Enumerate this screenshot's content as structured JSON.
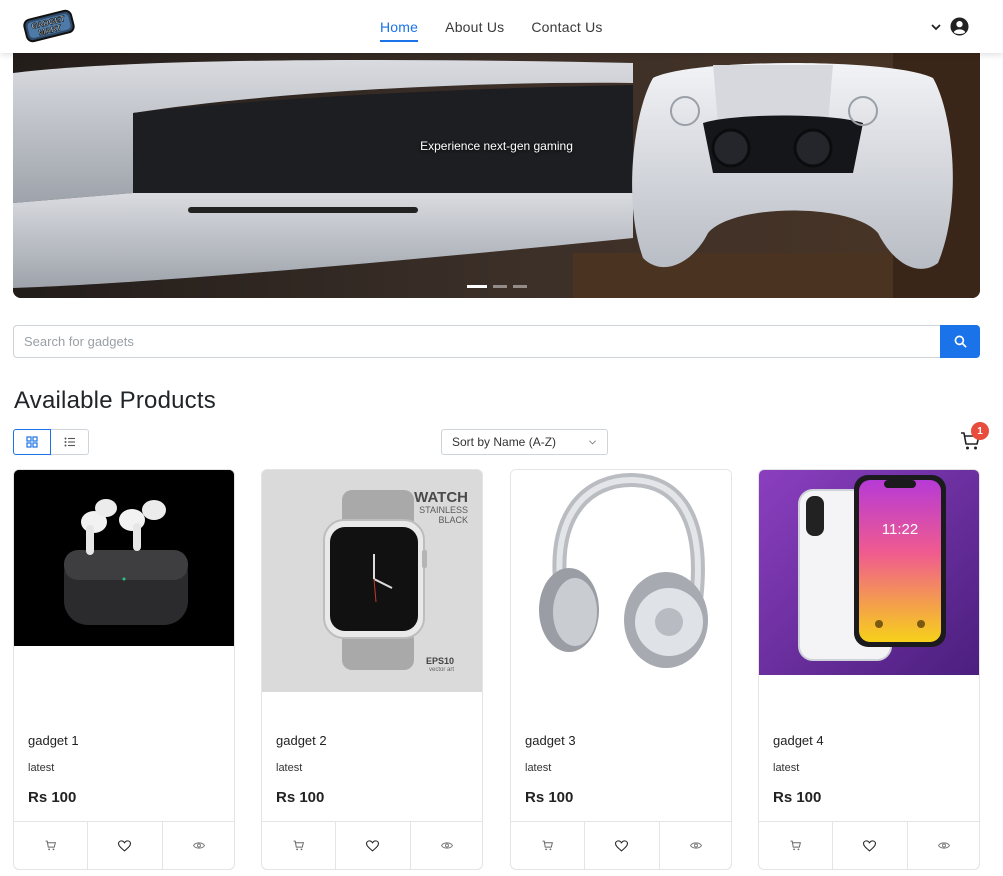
{
  "navbar": {
    "logo_text": "GADGET MART",
    "links": [
      {
        "label": "Home",
        "active": true
      },
      {
        "label": "About Us",
        "active": false
      },
      {
        "label": "Contact Us",
        "active": false
      }
    ],
    "icons": [
      "chevron-down-icon",
      "user-circle-icon"
    ]
  },
  "hero": {
    "caption": "Experience next-gen gaming",
    "slides": 3,
    "active_slide": 1
  },
  "search": {
    "placeholder": "Search for gadgets",
    "value": "",
    "button_icon": "search-icon"
  },
  "products_section": {
    "heading": "Available Products",
    "view_modes": [
      "grid",
      "list"
    ],
    "active_view": "grid",
    "sort": {
      "selected": "Sort by Name (A-Z)"
    },
    "cart_count": "1"
  },
  "products": [
    {
      "name": "gadget 1",
      "tag": "latest",
      "price": "Rs 100",
      "image": "airpods"
    },
    {
      "name": "gadget 2",
      "tag": "latest",
      "price": "Rs 100",
      "image": "watch",
      "image_text": {
        "title": "WATCH",
        "sub1": "STAINLESS",
        "sub2": "BLACK",
        "badge": "EPS10",
        "badge_sub": "vector art"
      }
    },
    {
      "name": "gadget 3",
      "tag": "latest",
      "price": "Rs 100",
      "image": "headphones"
    },
    {
      "name": "gadget 4",
      "tag": "latest",
      "price": "Rs 100",
      "image": "phone",
      "image_text": {
        "time": "11:22"
      }
    }
  ],
  "colors": {
    "accent": "#1a73e8",
    "badge": "#e74c3c",
    "border": "#e4e4e4"
  }
}
